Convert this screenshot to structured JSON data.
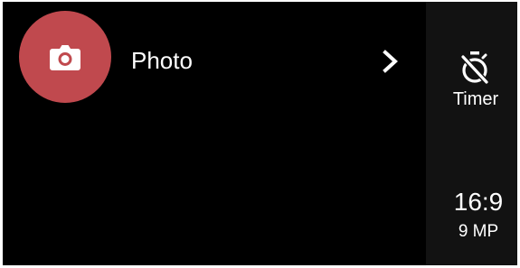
{
  "mode": {
    "label": "Photo",
    "icon": "camera-icon",
    "accent": "#c0494e",
    "arrow_icon": "chevron-right-icon"
  },
  "side_panel": {
    "timer": {
      "label": "Timer",
      "icon": "timer-off-icon"
    },
    "aspect": {
      "ratio": "16:9",
      "resolution": "9 MP"
    }
  },
  "colors": {
    "background": "#000000",
    "side_background": "#121212",
    "text": "#ffffff"
  }
}
